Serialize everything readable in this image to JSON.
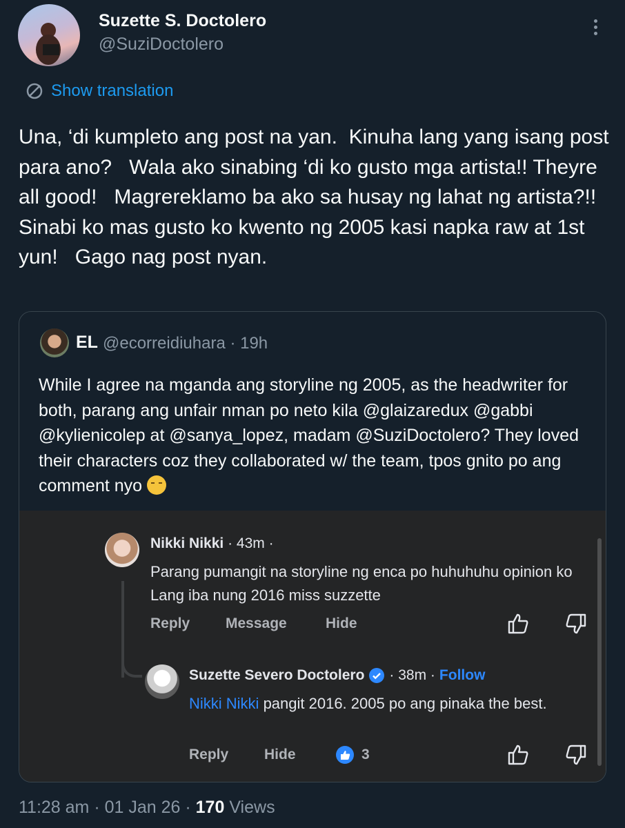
{
  "tweet": {
    "author_name": "Suzette S. Doctolero",
    "author_handle": "@SuziDoctolero",
    "translate_label": "Show translation",
    "text": "Una, ‘di kumpleto ang post na yan.  Kinuha lang yang isang post para ano?   Wala ako sinabing ‘di ko gusto mga artista!! Theyre all good!   Magrereklamo ba ako sa husay ng lahat ng artista?!! Sinabi ko mas gusto ko kwento ng 2005 kasi napka raw at 1st yun!   Gago nag post nyan.",
    "time": "11:28 am",
    "date": "01 Jan 26",
    "views_count": "170",
    "views_label": "Views"
  },
  "quote": {
    "author_name": "EL",
    "author_meta": "@ecorreidiuhara · 19h",
    "text": "While I agree na mganda ang storyline ng 2005, as the headwriter for both, parang ang unfair nman po neto kila @glaizaredux @gabbi @kylienicolep at @sanya_lopez, madam @SuziDoctolero? They loved their characters coz they collaborated w/ the team, tpos gnito po ang comment nyo"
  },
  "fb": {
    "comment1": {
      "name": "Nikki Nikki",
      "meta": " · 43m ·",
      "text": "Parang pumangit na storyline ng enca po huhuhuhu opinion ko Lang iba nung 2016 miss suzzette",
      "reply": "Reply",
      "message": "Message",
      "hide": "Hide"
    },
    "comment2": {
      "name": "Suzette Severo Doctolero",
      "meta": "· 38m ·",
      "follow": "Follow",
      "mention": "Nikki Nikki",
      "text": " pangit 2016. 2005 po ang pinaka the best.",
      "reply": "Reply",
      "hide": "Hide",
      "reaction_count": "3"
    }
  },
  "colors": {
    "background": "#15202b",
    "accent": "#1d9bf0",
    "fb_panel": "#242526",
    "fb_link": "#2d88ff"
  }
}
